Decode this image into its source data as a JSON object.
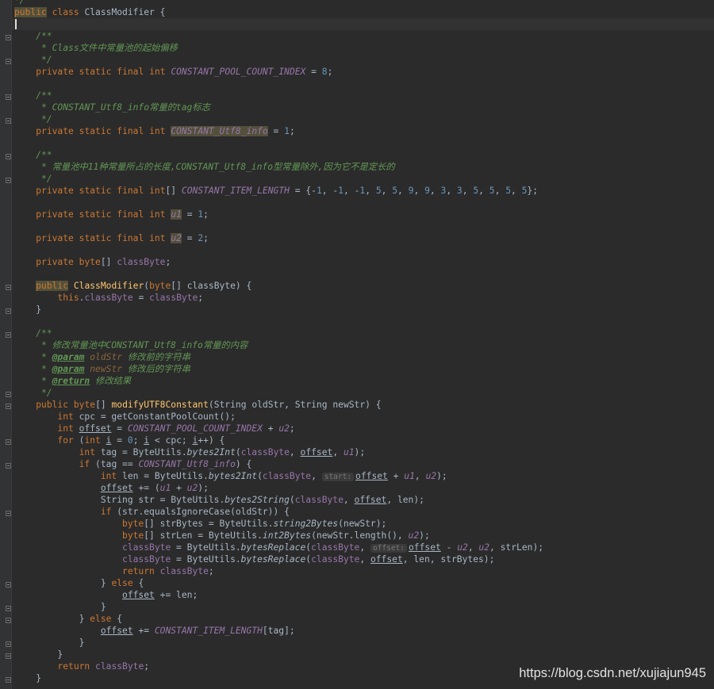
{
  "editor": {
    "lines": [
      "*/",
      "public class ClassModifier {",
      "",
      "    /**",
      "     * Class文件中常量池的起始偏移",
      "     */",
      "    private static final int CONSTANT_POOL_COUNT_INDEX = 8;",
      "",
      "    /**",
      "     * CONSTANT_Utf8_info常量的tag标志",
      "     */",
      "    private static final int CONSTANT_Utf8_info = 1;",
      "",
      "    /**",
      "     * 常量池中11种常量所占的长度,CONSTANT_Utf8_info型常量除外,因为它不是定长的",
      "     */",
      "    private static final int[] CONSTANT_ITEM_LENGTH = {-1, -1, -1, 5, 5, 9, 9, 3, 3, 5, 5, 5, 5};",
      "",
      "    private static final int u1 = 1;",
      "",
      "    private static final int u2 = 2;",
      "",
      "    private byte[] classByte;",
      "",
      "    public ClassModifier(byte[] classByte) {",
      "        this.classByte = classByte;",
      "    }",
      "",
      "    /**",
      "     * 修改常量池中CONSTANT_Utf8_info常量的内容",
      "     * @param oldStr 修改前的字符串",
      "     * @param newStr 修改后的字符串",
      "     * @return 修改结果",
      "     */",
      "    public byte[] modifyUTF8Constant(String oldStr, String newStr) {",
      "        int cpc = getConstantPoolCount();",
      "        int offset = CONSTANT_POOL_COUNT_INDEX + u2;",
      "        for (int i = 0; i < cpc; i++) {",
      "            int tag = ByteUtils.bytes2Int(classByte, offset, u1);",
      "            if (tag == CONSTANT_Utf8_info) {",
      "                int len = ByteUtils.bytes2Int(classByte,  start: offset + u1, u2);",
      "                offset += (u1 + u2);",
      "                String str = ByteUtils.bytes2String(classByte, offset, len);",
      "                if (str.equalsIgnoreCase(oldStr)) {",
      "                    byte[] strBytes = ByteUtils.string2Bytes(newStr);",
      "                    byte[] strLen = ByteUtils.int2Bytes(newStr.length(), u2);",
      "                    classByte = ByteUtils.bytesReplace(classByte,  offset: offset - u2, u2, strLen);",
      "                    classByte = ByteUtils.bytesReplace(classByte, offset, len, strBytes);",
      "                    return classByte;",
      "                } else {",
      "                    offset += len;",
      "                }",
      "            } else {",
      "                offset += CONSTANT_ITEM_LENGTH[tag];",
      "            }",
      "        }",
      "        return classByte;",
      "    }"
    ]
  },
  "watermark": "https://blog.csdn.net/xujiajun945",
  "colors": {
    "background": "#2b2b2b",
    "text": "#a9b7c6",
    "keyword": "#cc7832",
    "comment": "#629755",
    "field": "#9876aa",
    "method": "#ffc66d",
    "number": "#6897bb"
  }
}
